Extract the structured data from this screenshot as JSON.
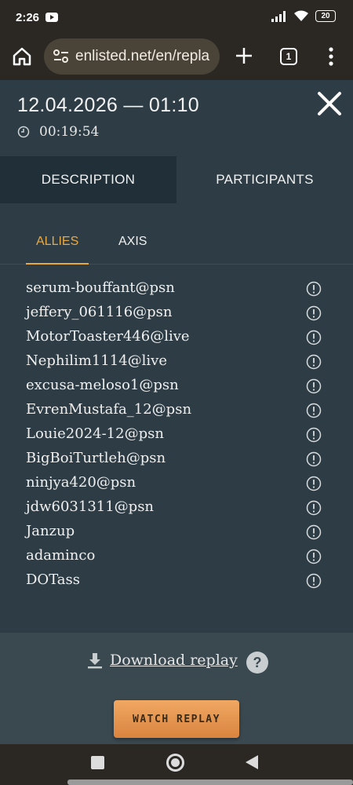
{
  "status_bar": {
    "time": "2:26",
    "battery": "20"
  },
  "browser": {
    "url": "enlisted.net/en/repla",
    "tab_count": "1"
  },
  "replay": {
    "date": "12.04.2026 — 01:10",
    "duration": "00:19:54",
    "tabs": {
      "description": "DESCRIPTION",
      "participants": "PARTICIPANTS"
    },
    "sub_tabs": {
      "allies": "ALLIES",
      "axis": "AXIS"
    },
    "players": [
      "serum-bouffant@psn",
      "jeffery_061116@psn",
      "MotorToaster446@live",
      "Nephilim1114@live",
      "excusa-meloso1@psn",
      "EvrenMustafa_12@psn",
      "Louie2024-12@psn",
      "BigBoiTurtleh@psn",
      "ninjya420@psn",
      "jdw6031311@psn",
      "Janzup",
      "adaminco",
      "DOTass"
    ],
    "download_label": "Download replay",
    "help_label": "?",
    "watch_label": "WATCH REPLAY"
  },
  "colors": {
    "accent": "#e9a940",
    "modal_bg": "#2e3d45",
    "button": "#e39a52"
  }
}
